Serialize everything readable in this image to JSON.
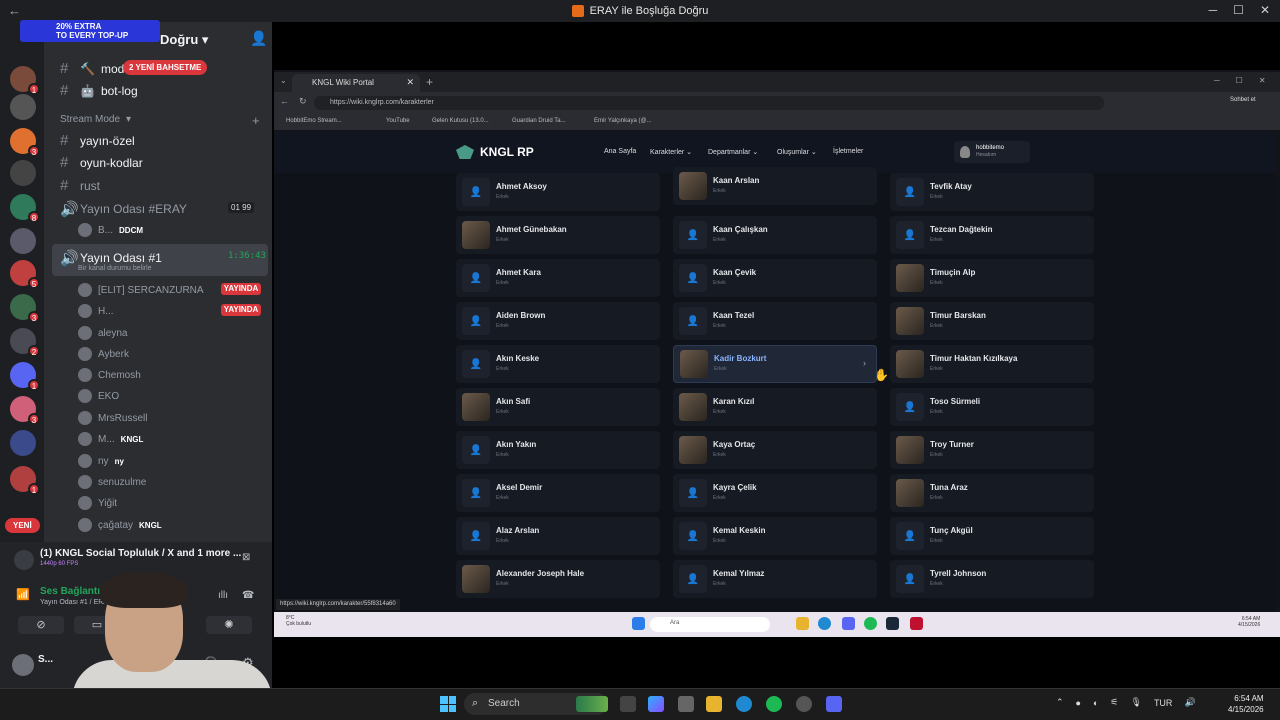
{
  "window": {
    "title": "ERAY ile Boşluğa Doğru"
  },
  "discord": {
    "server_title": "Doğru",
    "promo": {
      "line1": "20% EXTRA",
      "line2": "TO EVERY TOP-UP"
    },
    "new_badge": "2 YENİ BAHSETME",
    "yeni": "YENİ",
    "stream_mode": "Stream Mode",
    "channels": [
      {
        "name": "mod",
        "icon": "hammer-icon"
      },
      {
        "name": "bot-log",
        "icon": "robot-icon"
      },
      {
        "name": "yayın-özel"
      },
      {
        "name": "oyun-kodlar"
      },
      {
        "name": "rust"
      }
    ],
    "voice1": {
      "name": "Yayın Odası #ERAY",
      "counts": [
        "01",
        "99"
      ],
      "user": "B...",
      "user_tag": "DDCM"
    },
    "voice2": {
      "name": "Yayın Odası #1",
      "timer": "1:36:43",
      "status": "Bir kanal durumu belirle"
    },
    "voice_users": [
      {
        "name": "[ELIT] SERCANZURNA",
        "live": "YAYINDA"
      },
      {
        "name": "H...",
        "live": "YAYINDA"
      },
      {
        "name": "aleyna"
      },
      {
        "name": "Ayberk"
      },
      {
        "name": "Chemosh"
      },
      {
        "name": "EKO"
      },
      {
        "name": "MrsRussell"
      },
      {
        "name": "M...",
        "tag": "KNGL"
      },
      {
        "name": "ny",
        "tag": "ny"
      },
      {
        "name": "senuzulme"
      },
      {
        "name": "Yiğit"
      },
      {
        "name": "çağatay",
        "tag": "KNGL"
      }
    ],
    "activity": {
      "title": "(1) KNGL Social Topluluk / X and 1 more ...",
      "quality": "1440p 60 FPS"
    },
    "voice_panel": {
      "title": "Ses Bağlantısı K",
      "sub": "Yayın Odası #1 / ERA"
    },
    "user": {
      "name": "S..."
    }
  },
  "browser": {
    "tab_title": "KNGL Wiki Portal",
    "url": "https://wiki.knglrp.com/karakterler",
    "bookmarks": [
      "HobbitEmo Stream...",
      "YouTube",
      "Gelen Kutusu (13.0...",
      "Guardian Druid Ta...",
      "Emir Yalçınkaya (@..."
    ],
    "profile_btn": "Sohbet et",
    "status_url": "https://wiki.knglrp.com/karakter/55f8314a60"
  },
  "site": {
    "brand": "KNGL RP",
    "nav": [
      "Ana Sayfa",
      "Karakterler",
      "Departmanlar",
      "Oluşumlar",
      "İşletmeler"
    ],
    "account": {
      "name": "hobbitemo",
      "role": "Hesabım"
    },
    "gender": "Erkek",
    "columns": [
      [
        {
          "name": "Ahmet Aksoy"
        },
        {
          "name": "Ahmet Günebakan",
          "img": true
        },
        {
          "name": "Ahmet Kara"
        },
        {
          "name": "Aiden Brown"
        },
        {
          "name": "Akın Keske"
        },
        {
          "name": "Akın Safi",
          "img": true
        },
        {
          "name": "Akın Yakın"
        },
        {
          "name": "Aksel Demir"
        },
        {
          "name": "Alaz Arslan"
        },
        {
          "name": "Alexander Joseph Hale",
          "img": true
        }
      ],
      [
        {
          "name": "Kaan Arslan",
          "img": true
        },
        {
          "name": "Kaan Çalışkan"
        },
        {
          "name": "Kaan Çevik"
        },
        {
          "name": "Kaan Tezel"
        },
        {
          "name": "Kadir Bozkurt",
          "img": true,
          "hl": true
        },
        {
          "name": "Karan Kızıl",
          "img": true
        },
        {
          "name": "Kaya Ortaç",
          "img": true
        },
        {
          "name": "Kayra Çelik"
        },
        {
          "name": "Kemal Keskin"
        },
        {
          "name": "Kemal Yılmaz"
        }
      ],
      [
        {
          "name": "Tevfik Atay"
        },
        {
          "name": "Tezcan Dağtekin"
        },
        {
          "name": "Timuçin Alp",
          "img": true
        },
        {
          "name": "Timur Barskan",
          "img": true
        },
        {
          "name": "Timur Haktan Kızılkaya",
          "img": true
        },
        {
          "name": "Toso Sürmeli"
        },
        {
          "name": "Troy Turner",
          "img": true
        },
        {
          "name": "Tuna Araz",
          "img": true
        },
        {
          "name": "Tunç Akgül"
        },
        {
          "name": "Tyrell Johnson"
        }
      ]
    ]
  },
  "inner_taskbar": {
    "weather": "8°C",
    "weather_sub": "Çok bulutlu",
    "search": "Ara",
    "time": "6:54 AM",
    "date": "4/15/2026"
  },
  "taskbar": {
    "search": "Search",
    "lang": "TUR",
    "time": "6:54 AM",
    "date": "4/15/2026"
  }
}
